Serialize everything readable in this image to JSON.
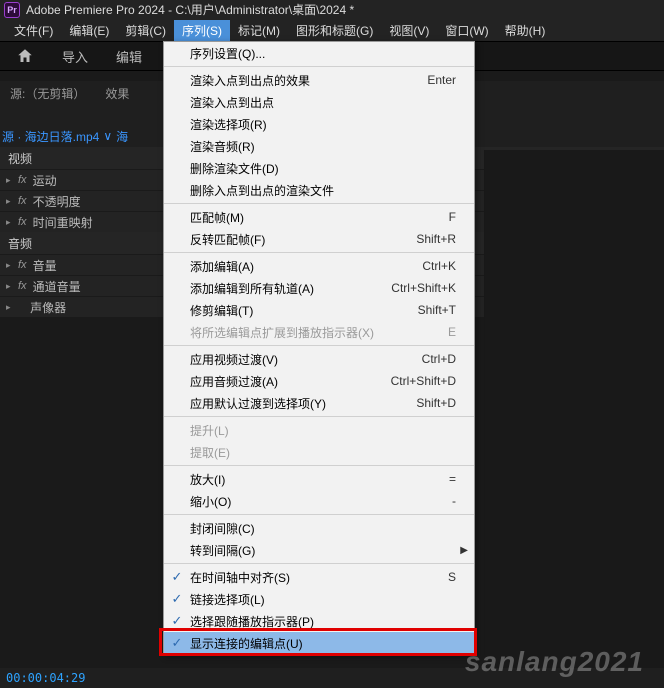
{
  "titlebar": {
    "logo": "Pr",
    "text": "Adobe Premiere Pro 2024 - C:\\用户\\Administrator\\桌面\\2024 *"
  },
  "menubar": [
    {
      "label": "文件(F)"
    },
    {
      "label": "编辑(E)"
    },
    {
      "label": "剪辑(C)"
    },
    {
      "label": "序列(S)",
      "open": true
    },
    {
      "label": "标记(M)"
    },
    {
      "label": "图形和标题(G)"
    },
    {
      "label": "视图(V)"
    },
    {
      "label": "窗口(W)"
    },
    {
      "label": "帮助(H)"
    }
  ],
  "toolbar": {
    "import": "导入",
    "edit": "编辑"
  },
  "panels": {
    "source": "源:（无剪辑）",
    "effects": "效果"
  },
  "source_tab": {
    "clip": "源 · 海边日落.mp4",
    "arrow": "∨",
    "seq": "海"
  },
  "sections": {
    "video": "视频",
    "audio": "音频"
  },
  "props": {
    "motion": "运动",
    "opacity": "不透明度",
    "timeremap": "时间重映射",
    "volume": "音量",
    "channel": "通道音量",
    "panner": "声像器"
  },
  "timecode": "00:00:04:29",
  "watermark": "sanlang2021",
  "menu": [
    {
      "label": "序列设置(Q)...",
      "accel": ""
    },
    {
      "sep": true
    },
    {
      "label": "渲染入点到出点的效果",
      "accel": "Enter"
    },
    {
      "label": "渲染入点到出点",
      "accel": ""
    },
    {
      "label": "渲染选择项(R)",
      "accel": ""
    },
    {
      "label": "渲染音频(R)",
      "accel": ""
    },
    {
      "label": "删除渲染文件(D)",
      "accel": ""
    },
    {
      "label": "删除入点到出点的渲染文件",
      "accel": ""
    },
    {
      "sep": true
    },
    {
      "label": "匹配帧(M)",
      "accel": "F"
    },
    {
      "label": "反转匹配帧(F)",
      "accel": "Shift+R"
    },
    {
      "sep": true
    },
    {
      "label": "添加编辑(A)",
      "accel": "Ctrl+K"
    },
    {
      "label": "添加编辑到所有轨道(A)",
      "accel": "Ctrl+Shift+K"
    },
    {
      "label": "修剪编辑(T)",
      "accel": "Shift+T"
    },
    {
      "label": "将所选编辑点扩展到播放指示器(X)",
      "accel": "E",
      "disabled": true
    },
    {
      "sep": true
    },
    {
      "label": "应用视频过渡(V)",
      "accel": "Ctrl+D"
    },
    {
      "label": "应用音频过渡(A)",
      "accel": "Ctrl+Shift+D"
    },
    {
      "label": "应用默认过渡到选择项(Y)",
      "accel": "Shift+D"
    },
    {
      "sep": true
    },
    {
      "label": "提升(L)",
      "accel": "",
      "disabled": true
    },
    {
      "label": "提取(E)",
      "accel": "",
      "disabled": true
    },
    {
      "sep": true
    },
    {
      "label": "放大(I)",
      "accel": "="
    },
    {
      "label": "缩小(O)",
      "accel": "-"
    },
    {
      "sep": true
    },
    {
      "label": "封闭间隙(C)",
      "accel": ""
    },
    {
      "label": "转到间隔(G)",
      "accel": "",
      "sub": true
    },
    {
      "sep": true
    },
    {
      "label": "在时间轴中对齐(S)",
      "accel": "S",
      "checked": true
    },
    {
      "label": "链接选择项(L)",
      "accel": "",
      "checked": true
    },
    {
      "label": "选择跟随播放指示器(P)",
      "accel": "",
      "checked": true
    },
    {
      "label": "显示连接的编辑点(U)",
      "accel": "",
      "checked": true,
      "highlight": true
    }
  ]
}
